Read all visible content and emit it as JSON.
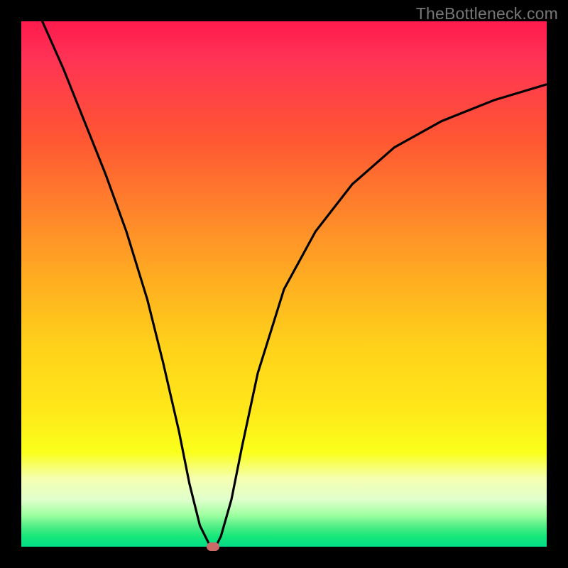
{
  "watermark": "TheBottleneck.com",
  "chart_data": {
    "type": "line",
    "title": "",
    "xlabel": "",
    "ylabel": "",
    "xlim": [
      0,
      100
    ],
    "ylim": [
      0,
      100
    ],
    "grid": false,
    "series": [
      {
        "name": "curve",
        "x": [
          0,
          4,
          8,
          12,
          16,
          20,
          24,
          27,
          30,
          32,
          34,
          36,
          37,
          38,
          40,
          42,
          45,
          50,
          56,
          63,
          71,
          80,
          90,
          100
        ],
        "y": [
          108,
          100,
          91,
          81,
          71,
          60,
          47,
          35,
          22,
          12,
          4,
          0,
          0,
          2,
          9,
          19,
          33,
          49,
          60,
          69,
          76,
          81,
          85,
          88
        ]
      }
    ],
    "marker": {
      "x": 36.5,
      "y": 0
    },
    "background_gradient": {
      "stops": [
        {
          "pct": 0,
          "color": "#ff1a4d"
        },
        {
          "pct": 50,
          "color": "#ffd21a"
        },
        {
          "pct": 100,
          "color": "#00dd88"
        }
      ]
    }
  }
}
